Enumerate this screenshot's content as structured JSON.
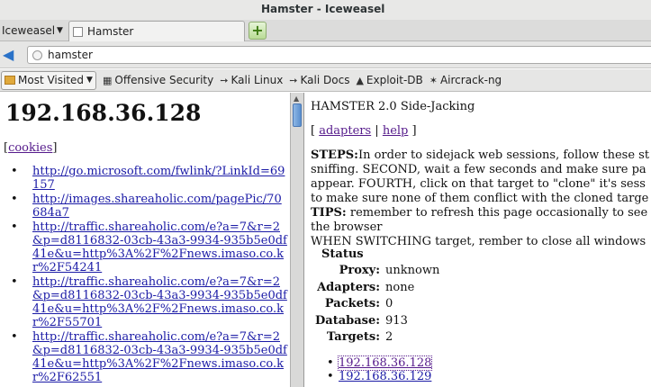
{
  "window": {
    "title": "Hamster - Iceweasel"
  },
  "tabbar": {
    "app_menu": "Iceweasel",
    "tab_title": "Hamster",
    "new_tab": "+"
  },
  "navbar": {
    "url": "hamster"
  },
  "bookmarks": [
    {
      "label": "Most Visited"
    },
    {
      "label": "Offensive Security"
    },
    {
      "label": "Kali Linux"
    },
    {
      "label": "Kali Docs"
    },
    {
      "label": "Exploit-DB"
    },
    {
      "label": "Aircrack-ng"
    }
  ],
  "left": {
    "heading": "192.168.36.128",
    "cookies_label": "cookies",
    "links": [
      "http://go.microsoft.com/fwlink/?LinkId=69157",
      "http://images.shareaholic.com/pagePic/70684a7",
      "http://traffic.shareaholic.com/e?a=7&r=2&p=d8116832-03cb-43a3-9934-935b5e0df41e&u=http%3A%2F%2Fnews.imaso.co.kr%2F54241",
      "http://traffic.shareaholic.com/e?a=7&r=2&p=d8116832-03cb-43a3-9934-935b5e0df41e&u=http%3A%2F%2Fnews.imaso.co.kr%2F55701",
      "http://traffic.shareaholic.com/e?a=7&r=2&p=d8116832-03cb-43a3-9934-935b5e0df41e&u=http%3A%2F%2Fnews.imaso.co.kr%2F62551"
    ]
  },
  "right": {
    "title": "HAMSTER 2.0 Side-Jacking",
    "nav_adapters": "adapters",
    "nav_help": "help",
    "steps_label": "STEPS:",
    "steps_lines": [
      "In order to sidejack web sessions, follow these st",
      "sniffing. SECOND, wait a few seconds and make sure pa",
      "appear. FOURTH, click on that target to \"clone\" it's sess",
      "to make sure none of them conflict with the cloned targe"
    ],
    "tips_label": "TIPS:",
    "tips_lines": [
      " remember to refresh this page occasionally to see",
      "the browser"
    ],
    "switching_text": "WHEN SWITCHING target, rember to close all windows",
    "status": {
      "heading": "Status",
      "rows": [
        {
          "key": "Proxy:",
          "value": "unknown"
        },
        {
          "key": "Adapters:",
          "value": "none"
        },
        {
          "key": "Packets:",
          "value": "0"
        },
        {
          "key": "Database:",
          "value": "913"
        },
        {
          "key": "Targets:",
          "value": "2"
        }
      ]
    },
    "targets": [
      "192.168.36.128",
      "192.168.36.129"
    ]
  }
}
